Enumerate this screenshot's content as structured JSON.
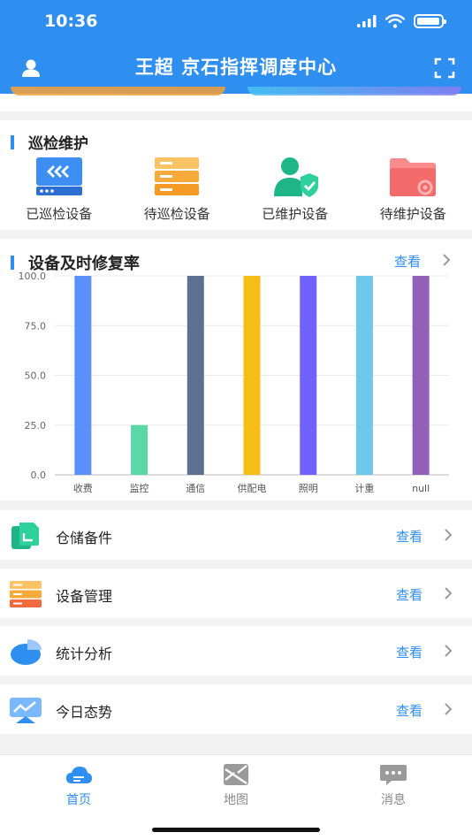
{
  "status": {
    "time": "10:36"
  },
  "header": {
    "title": "王超 京石指挥调度中心"
  },
  "patrol": {
    "title": "巡检维护",
    "items": [
      {
        "label": "已巡检设备",
        "icon": "server-rack-icon"
      },
      {
        "label": "待巡检设备",
        "icon": "server-stack-icon"
      },
      {
        "label": "已维护设备",
        "icon": "user-shield-icon"
      },
      {
        "label": "待维护设备",
        "icon": "folder-gear-icon"
      }
    ]
  },
  "repair": {
    "title": "设备及时修复率",
    "view_label": "查看"
  },
  "chart_data": {
    "type": "bar",
    "categories": [
      "收费",
      "监控",
      "通信",
      "供配电",
      "照明",
      "计重",
      "null"
    ],
    "values": [
      100,
      25,
      100,
      100,
      100,
      100,
      100
    ],
    "ylim": [
      0,
      100
    ],
    "yticks": [
      "100.0",
      "75.0",
      "50.0",
      "25.0",
      "0.0"
    ],
    "colors": [
      "#5b8ff9",
      "#5ad8a6",
      "#5d7092",
      "#f6bd16",
      "#7262fd",
      "#6dc8ec",
      "#945fb9"
    ]
  },
  "rows": [
    {
      "label": "仓储备件",
      "view_label": "查看",
      "icon": "warehouse-doc-icon"
    },
    {
      "label": "设备管理",
      "view_label": "查看",
      "icon": "server-stack-icon"
    },
    {
      "label": "统计分析",
      "view_label": "查看",
      "icon": "pie-chart-icon"
    },
    {
      "label": "今日态势",
      "view_label": "查看",
      "icon": "trend-chart-icon"
    }
  ],
  "tabs": [
    {
      "label": "首页",
      "active": true,
      "icon": "cloud-home-icon"
    },
    {
      "label": "地图",
      "active": false,
      "icon": "map-icon"
    },
    {
      "label": "消息",
      "active": false,
      "icon": "message-icon"
    }
  ],
  "colors": {
    "primary": "#2f8ff0",
    "background": "#f2f2f2"
  }
}
